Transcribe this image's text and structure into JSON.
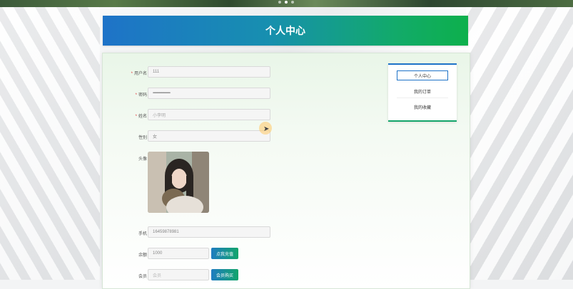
{
  "header": {
    "title": "个人中心"
  },
  "form": {
    "username": {
      "label": "用户名",
      "value": "111"
    },
    "password": {
      "label": "密码",
      "value": "••••••••••••••••••••••••••••••••"
    },
    "name": {
      "label": "姓名",
      "placeholder": "小李明"
    },
    "gender": {
      "label": "性别",
      "value": "女"
    },
    "avatar": {
      "label": "头像"
    },
    "phone": {
      "label": "手机",
      "value": "16459878981"
    },
    "balance": {
      "label": "余额",
      "value": "1000",
      "button": "点我充值"
    },
    "member": {
      "label": "会员",
      "placeholder": "会员",
      "button": "会员购买"
    }
  },
  "sidebar": {
    "items": [
      {
        "label": "个人中心",
        "active": true
      },
      {
        "label": "我的订单",
        "active": false
      },
      {
        "label": "我的收藏",
        "active": false
      }
    ]
  },
  "colors": {
    "primary": "#1e73c8",
    "accent": "#13a56b",
    "required": "#e4393c"
  }
}
